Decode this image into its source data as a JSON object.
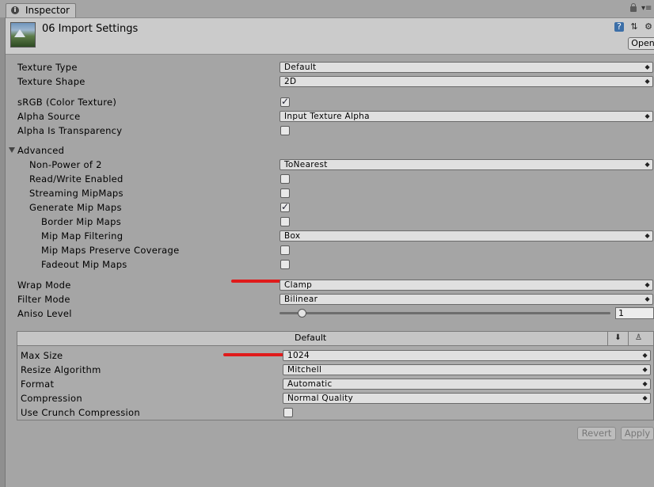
{
  "tab": {
    "label": "Inspector"
  },
  "header": {
    "title": "06 Import Settings",
    "open_label": "Open"
  },
  "fields": {
    "texture_type": {
      "label": "Texture Type",
      "value": "Default"
    },
    "texture_shape": {
      "label": "Texture Shape",
      "value": "2D"
    },
    "srgb": {
      "label": "sRGB (Color Texture)",
      "checked": true
    },
    "alpha_source": {
      "label": "Alpha Source",
      "value": "Input Texture Alpha"
    },
    "alpha_transparency": {
      "label": "Alpha Is Transparency",
      "checked": false
    },
    "advanced": {
      "label": "Advanced"
    },
    "non_power_2": {
      "label": "Non-Power of 2",
      "value": "ToNearest"
    },
    "read_write": {
      "label": "Read/Write Enabled",
      "checked": false
    },
    "streaming_mipmaps": {
      "label": "Streaming MipMaps",
      "checked": false
    },
    "generate_mipmaps": {
      "label": "Generate Mip Maps",
      "checked": true
    },
    "border_mipmaps": {
      "label": "Border Mip Maps",
      "checked": false
    },
    "mipmap_filtering": {
      "label": "Mip Map Filtering",
      "value": "Box"
    },
    "mipmaps_coverage": {
      "label": "Mip Maps Preserve Coverage",
      "checked": false
    },
    "fadeout_mipmaps": {
      "label": "Fadeout Mip Maps",
      "checked": false
    },
    "wrap_mode": {
      "label": "Wrap Mode",
      "value": "Clamp"
    },
    "filter_mode": {
      "label": "Filter Mode",
      "value": "Bilinear"
    },
    "aniso_level": {
      "label": "Aniso Level",
      "value": "1",
      "slider_fraction": 0.0625
    }
  },
  "platform": {
    "tab_label": "Default",
    "max_size": {
      "label": "Max Size",
      "value": "1024"
    },
    "resize_algorithm": {
      "label": "Resize Algorithm",
      "value": "Mitchell"
    },
    "format": {
      "label": "Format",
      "value": "Automatic"
    },
    "compression": {
      "label": "Compression",
      "value": "Normal Quality"
    },
    "crunch": {
      "label": "Use Crunch Compression",
      "checked": false
    }
  },
  "footer": {
    "revert_label": "Revert",
    "apply_label": "Apply"
  },
  "icons": {
    "tab": "info-icon",
    "lock": "lock-icon",
    "menu": "menu-icon",
    "help": "help-icon",
    "presets": "presets-icon",
    "settings": "gear-icon",
    "download": "download-icon",
    "android": "android-icon",
    "dropdown": "dropdown-arrow-icon",
    "check": "checkmark-icon"
  },
  "colors": {
    "annotation_red": "#e01b1b"
  }
}
